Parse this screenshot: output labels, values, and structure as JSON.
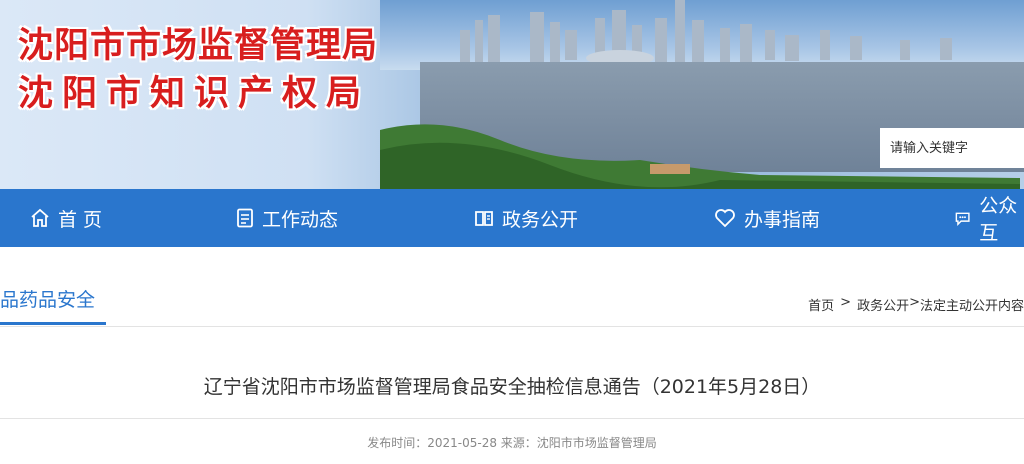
{
  "header": {
    "title_line1": "沈阳市市场监督管理局",
    "title_line2": "沈阳市知识产权局",
    "search_placeholder": "请输入关键字"
  },
  "nav": {
    "items": [
      {
        "label": "首 页",
        "icon": "home-icon"
      },
      {
        "label": "工作动态",
        "icon": "document-icon"
      },
      {
        "label": "政务公开",
        "icon": "book-icon"
      },
      {
        "label": "办事指南",
        "icon": "heart-icon"
      },
      {
        "label": "公众互",
        "icon": "chat-icon"
      }
    ]
  },
  "section": {
    "title": "品药品安全"
  },
  "breadcrumb": {
    "home": "首页",
    "sep1": ">",
    "level1": "政务公开",
    "sep2": ">",
    "level2": "法定主动公开内容"
  },
  "article": {
    "title": "辽宁省沈阳市市场监督管理局食品安全抽检信息通告（2021年5月28日）",
    "meta": "发布时间：2021-05-28 来源：沈阳市市场监督管理局"
  },
  "colors": {
    "nav_bg": "#2a76cd",
    "title_red": "#d81e1e",
    "accent": "#2a76cd"
  }
}
